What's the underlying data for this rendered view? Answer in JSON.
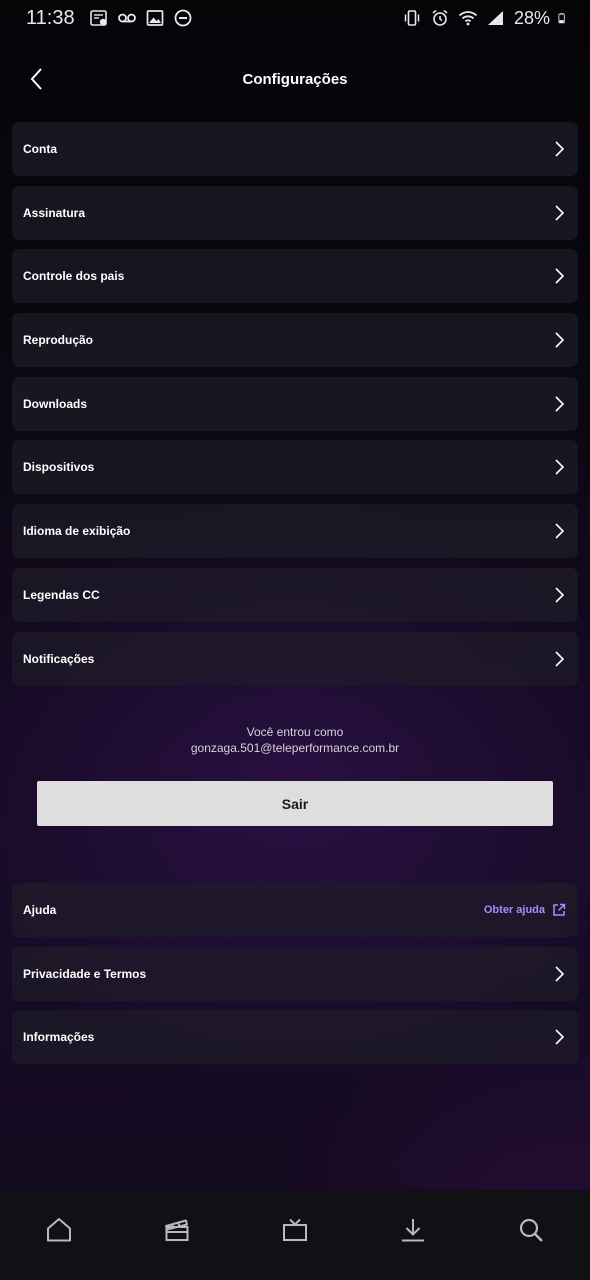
{
  "status_bar": {
    "time": "11:38",
    "battery": "28%",
    "left_icons": [
      "news-icon",
      "voicemail-icon",
      "image-icon",
      "do-not-disturb-icon"
    ],
    "right_icons": [
      "vibrate-icon",
      "alarm-icon",
      "wifi-icon",
      "signal-icon",
      "battery-icon"
    ]
  },
  "header": {
    "title": "Configurações",
    "back_icon": "chevron-left-icon"
  },
  "menu": {
    "items": [
      {
        "label": "Conta"
      },
      {
        "label": "Assinatura"
      },
      {
        "label": "Controle dos pais"
      },
      {
        "label": "Reprodução"
      },
      {
        "label": "Downloads"
      },
      {
        "label": "Dispositivos"
      },
      {
        "label": "Idioma de exibição"
      },
      {
        "label": "Legendas CC"
      },
      {
        "label": "Notificações"
      }
    ]
  },
  "account": {
    "logged_in_as": "Você entrou como",
    "email": "gonzaga.501@teleperformance.com.br",
    "signout_label": "Sair"
  },
  "menu2": {
    "help_label": "Ajuda",
    "help_link": "Obter ajuda",
    "help_link_icon": "external-link-icon",
    "items": [
      {
        "label": "Privacidade e Termos"
      },
      {
        "label": "Informações"
      }
    ]
  },
  "bottom_nav": {
    "items": [
      "home-icon",
      "movies-icon",
      "tv-icon",
      "downloads-icon",
      "search-icon"
    ]
  },
  "colors": {
    "accent": "#a98bff",
    "button_bg": "#dedede",
    "item_bg": "#1e1c28",
    "nav_bg": "#111014"
  }
}
